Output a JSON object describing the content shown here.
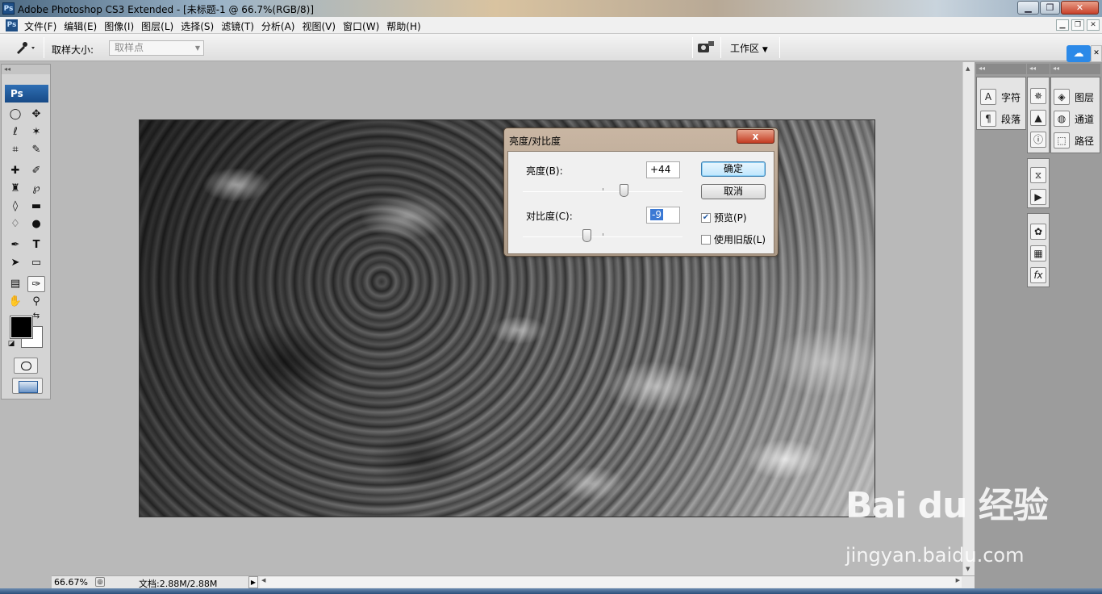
{
  "window": {
    "title": "Adobe Photoshop CS3 Extended - [未标题-1 @ 66.7%(RGB/8)]",
    "app_badge": "Ps"
  },
  "menu": {
    "items": [
      "文件(F)",
      "编辑(E)",
      "图像(I)",
      "图层(L)",
      "选择(S)",
      "滤镜(T)",
      "分析(A)",
      "视图(V)",
      "窗口(W)",
      "帮助(H)"
    ]
  },
  "options_bar": {
    "sample_size_label": "取样大小:",
    "sample_size_value": "取样点",
    "workspace_label": "工作区"
  },
  "toolbox": {
    "badge": "Ps"
  },
  "status_bar": {
    "zoom": "66.67%",
    "doc_info": "文档:2.88M/2.88M"
  },
  "right_panels": {
    "text_group": [
      {
        "icon": "character-icon",
        "label": "字符"
      },
      {
        "icon": "paragraph-icon",
        "label": "段落"
      }
    ],
    "layers_group": [
      {
        "icon": "layers-icon",
        "label": "图层"
      },
      {
        "icon": "channels-icon",
        "label": "通道"
      },
      {
        "icon": "paths-icon",
        "label": "路径"
      }
    ]
  },
  "dialog": {
    "title": "亮度/对比度",
    "close_label": "x",
    "brightness_label": "亮度(B):",
    "brightness_value": "+44",
    "contrast_label": "对比度(C):",
    "contrast_value": "-9",
    "ok_label": "确定",
    "cancel_label": "取消",
    "preview_label": "预览(P)",
    "preview_checked": true,
    "legacy_label": "使用旧版(L)",
    "legacy_checked": false,
    "brightness_slider_fraction": 0.63,
    "contrast_slider_fraction": 0.4
  },
  "watermark": {
    "logo": "Bai du 经验",
    "url": "jingyan.baidu.com"
  }
}
